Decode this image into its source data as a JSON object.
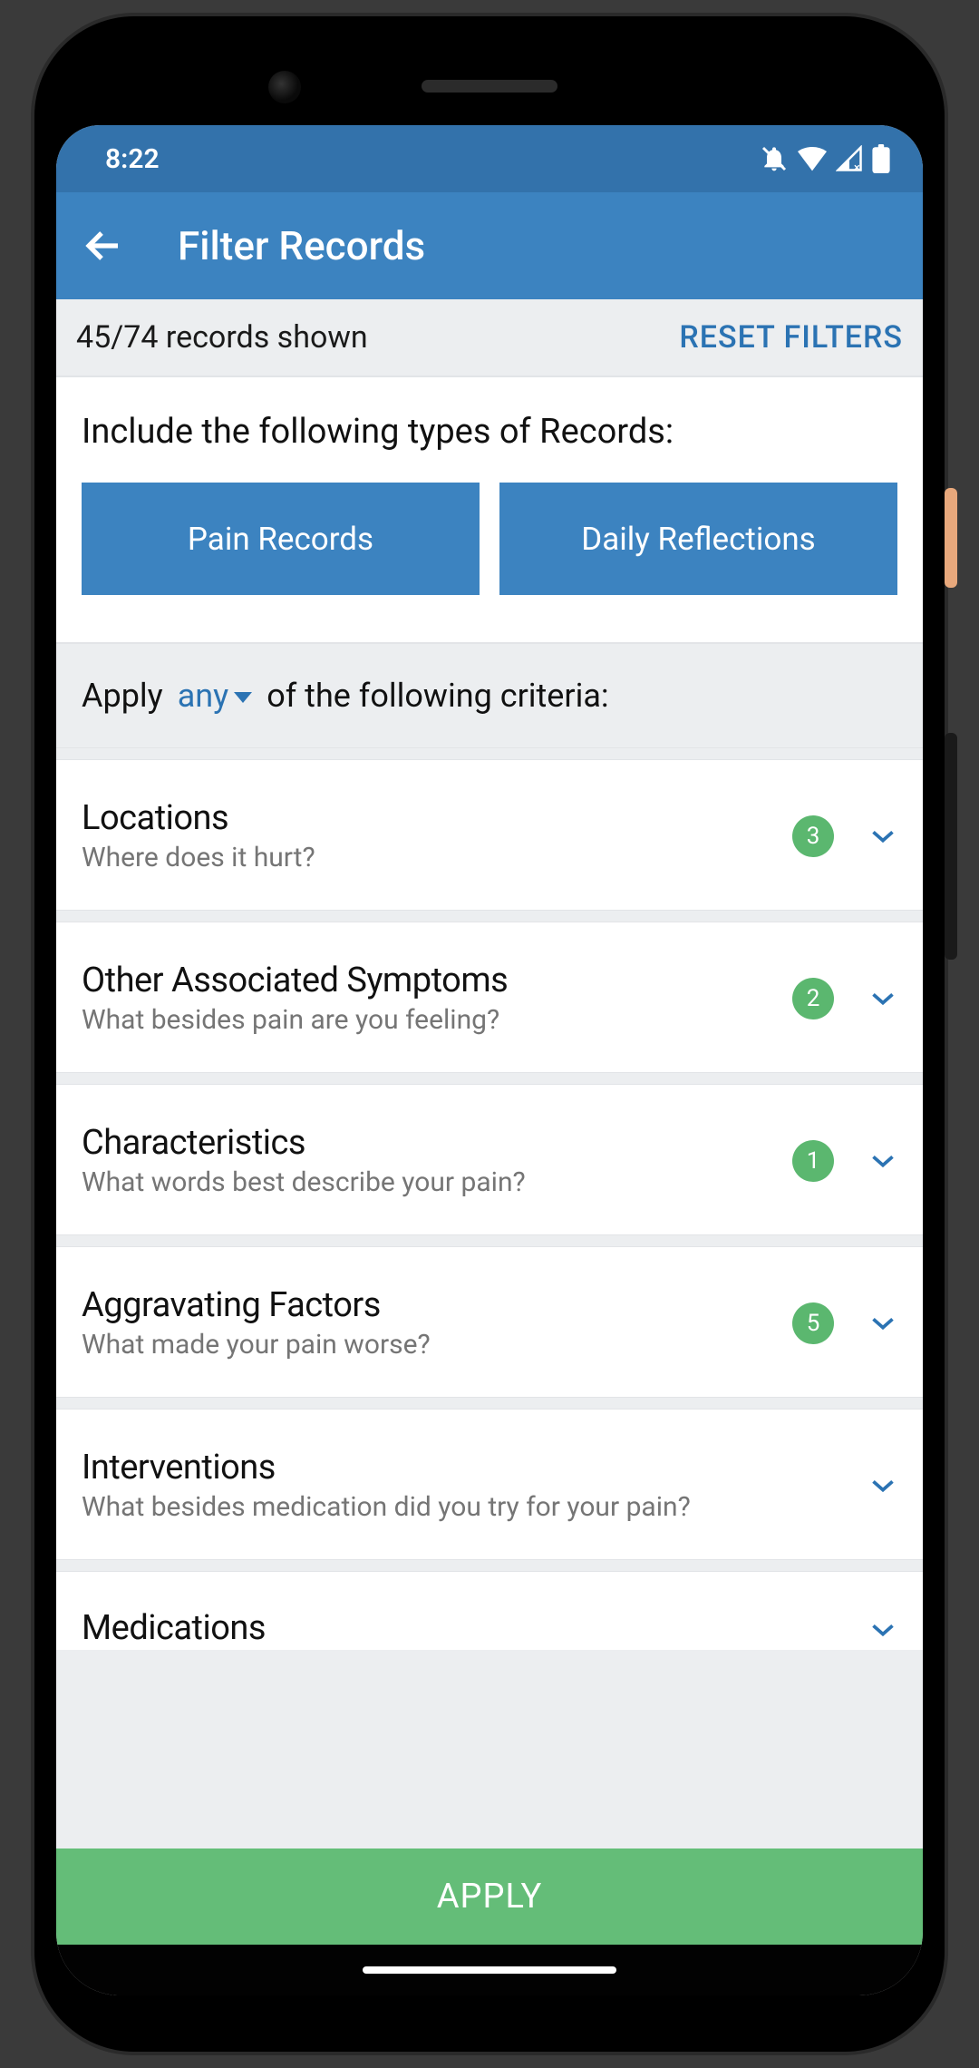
{
  "status": {
    "time": "8:22"
  },
  "header": {
    "title": "Filter Records"
  },
  "subheader": {
    "records_shown": "45/74 records shown",
    "reset_label": "RESET FILTERS"
  },
  "types": {
    "heading": "Include the following types of Records:",
    "pain_label": "Pain Records",
    "reflections_label": "Daily Reflections"
  },
  "criteria": {
    "prefix": "Apply",
    "dropdown_value": "any",
    "suffix": "of the following criteria:"
  },
  "rows": {
    "locations": {
      "title": "Locations",
      "sub": "Where does it hurt?",
      "badge": "3"
    },
    "symptoms": {
      "title": "Other Associated Symptoms",
      "sub": "What besides pain are you feeling?",
      "badge": "2"
    },
    "characteristics": {
      "title": "Characteristics",
      "sub": "What words best describe your pain?",
      "badge": "1"
    },
    "aggravating": {
      "title": "Aggravating Factors",
      "sub": "What made your pain worse?",
      "badge": "5"
    },
    "interventions": {
      "title": "Interventions",
      "sub": "What besides medication did you try for your pain?"
    },
    "medications": {
      "title": "Medications"
    }
  },
  "footer": {
    "apply_label": "APPLY"
  }
}
